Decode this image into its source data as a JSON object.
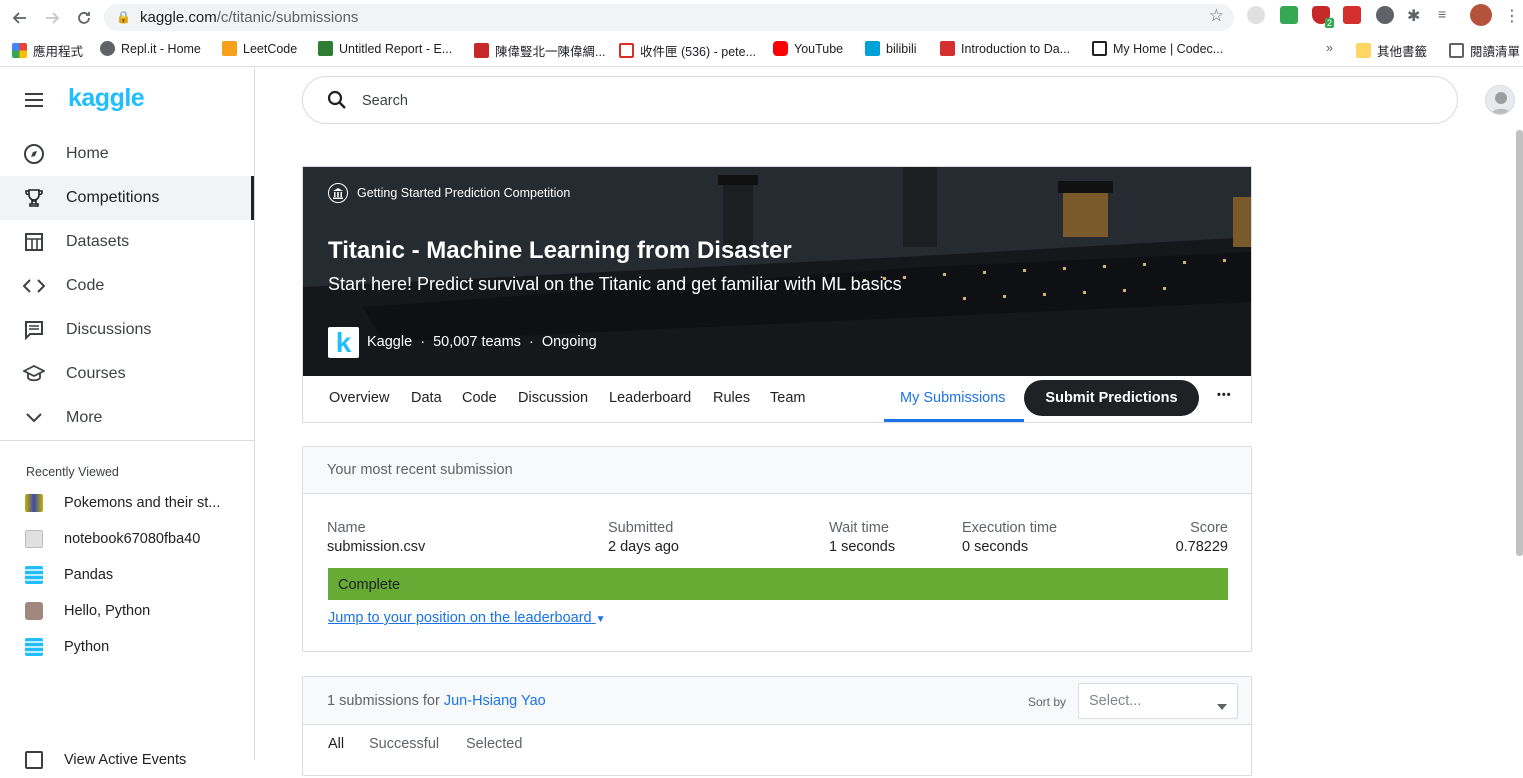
{
  "browser": {
    "url_domain": "kaggle.com",
    "url_path": "/c/titanic/submissions",
    "ext_badge": "2",
    "bookmarks": [
      {
        "label": "應用程式",
        "icon": "apps-grid-icon",
        "color": "#e94235"
      },
      {
        "label": "Repl.it - Home",
        "icon": "replit-icon",
        "color": "#5f6368"
      },
      {
        "label": "LeetCode",
        "icon": "leetcode-icon",
        "color": "#f89f1b"
      },
      {
        "label": "Untitled Report - E...",
        "icon": "m-logo-icon",
        "color": "#2e7d32"
      },
      {
        "label": "陳偉豎北一陳偉綢...",
        "icon": "image-icon",
        "color": "#c62828"
      },
      {
        "label": "收件匣 (536) - pete...",
        "icon": "gmail-icon",
        "color": "#d93025"
      },
      {
        "label": "YouTube",
        "icon": "youtube-icon",
        "color": "#ff0000"
      },
      {
        "label": "bilibili",
        "icon": "bilibili-icon",
        "color": "#00a1d6"
      },
      {
        "label": "Introduction to Da...",
        "icon": "udacity-icon",
        "color": "#d32f2f"
      },
      {
        "label": "My Home | Codec...",
        "icon": "codecademy-icon",
        "color": "#202124"
      }
    ],
    "overflow": "»",
    "other_bookmarks": "其他書籤",
    "reading_list": "閱讀清單"
  },
  "sidebar": {
    "logo": "kaggle",
    "items": [
      {
        "label": "Home",
        "icon": "compass-icon"
      },
      {
        "label": "Competitions",
        "icon": "trophy-icon"
      },
      {
        "label": "Datasets",
        "icon": "table-icon"
      },
      {
        "label": "Code",
        "icon": "code-brackets-icon"
      },
      {
        "label": "Discussions",
        "icon": "comments-icon"
      },
      {
        "label": "Courses",
        "icon": "graduation-cap-icon"
      },
      {
        "label": "More",
        "icon": "chevron-down-icon"
      }
    ],
    "recently_viewed_title": "Recently Viewed",
    "recent": [
      {
        "label": "Pokemons and their st...",
        "color": "#c8b400"
      },
      {
        "label": "notebook67080fba40",
        "color": "#9e9e9e"
      },
      {
        "label": "Pandas",
        "color": "#20beff"
      },
      {
        "label": "Hello, Python",
        "color": "#a1887f"
      },
      {
        "label": "Python",
        "color": "#20beff"
      }
    ],
    "bottom_item": "View Active Events"
  },
  "search": {
    "placeholder": "Search"
  },
  "competition": {
    "category": "Getting Started Prediction Competition",
    "title": "Titanic - Machine Learning from Disaster",
    "subtitle": "Start here! Predict survival on the Titanic and get familiar with ML basics",
    "host": "Kaggle",
    "sep": "·",
    "teams": "50,007 teams",
    "status": "Ongoing",
    "host_logo_letter": "k"
  },
  "tabs": [
    "Overview",
    "Data",
    "Code",
    "Discussion",
    "Leaderboard",
    "Rules",
    "Team"
  ],
  "active_tab": "My Submissions",
  "submit_label": "Submit Predictions",
  "more_label": "•••",
  "recent_submission": {
    "header": "Your most recent submission",
    "name_label": "Name",
    "name_value": "submission.csv",
    "submitted_label": "Submitted",
    "submitted_value": "2 days ago",
    "wait_label": "Wait time",
    "wait_value": "1 seconds",
    "exec_label": "Execution time",
    "exec_value": "0 seconds",
    "score_label": "Score",
    "score_value": "0.78229",
    "status": "Complete",
    "status_color": "#66ab34",
    "jump_link": "Jump to your position on the leaderboard"
  },
  "submissions_list": {
    "count_text": "1 submissions for",
    "user": "Jun-Hsiang Yao",
    "sort_by": "Sort by",
    "select_placeholder": "Select...",
    "filters": [
      "All",
      "Successful",
      "Selected"
    ]
  },
  "colors": {
    "kaggle_blue": "#20beff",
    "link_blue": "#1a73e8",
    "complete_green": "#66ab34"
  }
}
